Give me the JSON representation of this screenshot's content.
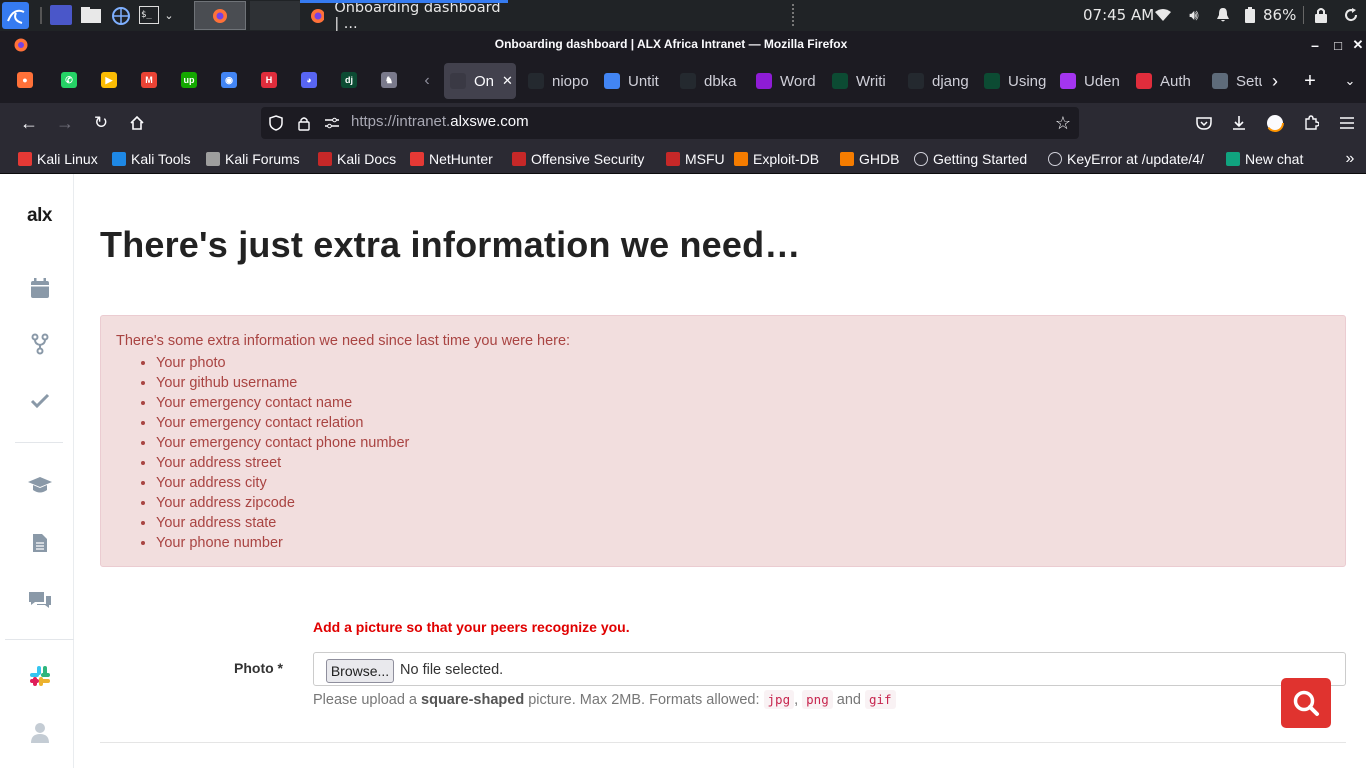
{
  "panel": {
    "active_task": "Onboarding dashboard | ...",
    "time": "07:45 AM",
    "battery": "86%"
  },
  "window": {
    "title": "Onboarding dashboard | ALX Africa Intranet — Mozilla Firefox",
    "minimize": "–",
    "maximize": "□",
    "close": "✕"
  },
  "tabs": {
    "pinned": [
      {
        "name": "firefox",
        "color": "#ff7139",
        "glyph": "●"
      },
      {
        "name": "whatsapp",
        "color": "#25d366",
        "glyph": "✆"
      },
      {
        "name": "play",
        "color": "#fbbc04",
        "glyph": "▶"
      },
      {
        "name": "gmail",
        "color": "#ea4335",
        "glyph": "M"
      },
      {
        "name": "upwork",
        "color": "#14a800",
        "glyph": "up"
      },
      {
        "name": "chrome-like",
        "color": "#4285f4",
        "glyph": "◉"
      },
      {
        "name": "holberton",
        "color": "#e02d3c",
        "glyph": "H"
      },
      {
        "name": "discord",
        "color": "#5865f2",
        "glyph": "◕"
      },
      {
        "name": "django",
        "color": "#0c4b33",
        "glyph": "dj"
      },
      {
        "name": "unicorn",
        "color": "#7a7a8c",
        "glyph": "♞"
      }
    ],
    "open": [
      {
        "label": "On",
        "icon": "alx",
        "color": "#3a3944",
        "active": true
      },
      {
        "label": "niopo",
        "icon": "github",
        "color": "#24292f"
      },
      {
        "label": "Untit",
        "icon": "docs",
        "color": "#4285f4"
      },
      {
        "label": "dbka",
        "icon": "github",
        "color": "#24292f"
      },
      {
        "label": "Word",
        "icon": "u",
        "color": "#8e1cd6"
      },
      {
        "label": "Writi",
        "icon": "dj",
        "color": "#0c4b33"
      },
      {
        "label": "djang",
        "icon": "github",
        "color": "#24292f"
      },
      {
        "label": "Using",
        "icon": "dj",
        "color": "#0c4b33"
      },
      {
        "label": "Uden",
        "icon": "udemy",
        "color": "#a435f0"
      },
      {
        "label": "Auth",
        "icon": "dot",
        "color": "#e02d3c"
      },
      {
        "label": "Setu",
        "icon": "grid",
        "color": "#5e6b7a"
      }
    ]
  },
  "nav": {
    "url_prefix": "https://intranet.",
    "url_domain": "alxswe.com"
  },
  "bookmarks": [
    {
      "label": "Kali Linux",
      "color": "#e53935"
    },
    {
      "label": "Kali Tools",
      "color": "#1e88e5"
    },
    {
      "label": "Kali Forums",
      "color": "#9e9e9e"
    },
    {
      "label": "Kali Docs",
      "color": "#c62828"
    },
    {
      "label": "NetHunter",
      "color": "#e53935"
    },
    {
      "label": "Offensive Security",
      "color": "#c62828"
    },
    {
      "label": "MSFU",
      "color": "#c62828"
    },
    {
      "label": "Exploit-DB",
      "color": "#f57c00"
    },
    {
      "label": "GHDB",
      "color": "#f57c00"
    },
    {
      "label": "Getting Started",
      "color": "#cfcfd8"
    },
    {
      "label": "KeyError at /update/4/",
      "color": "#cfcfd8"
    },
    {
      "label": "New chat",
      "color": "#10a37f"
    }
  ],
  "sidebar": {
    "logo": "alx"
  },
  "page": {
    "heading": "There's just extra information we need…",
    "alert_intro": "There's some extra information we need since last time you were here:",
    "missing": [
      "Your photo",
      "Your github username",
      "Your emergency contact name",
      "Your emergency contact relation",
      "Your emergency contact phone number",
      "Your address street",
      "Your address city",
      "Your address zipcode",
      "Your address state",
      "Your phone number"
    ],
    "photo_prompt": "Add a picture so that your peers recognize you.",
    "photo_label": "Photo *",
    "browse_button": "Browse...",
    "file_status": "No file selected.",
    "help_pre": "Please upload a ",
    "help_bold": "square-shaped",
    "help_mid": " picture. Max 2MB. Formats allowed: ",
    "formats": [
      "jpg",
      "png",
      "gif"
    ],
    "format_sep": ", ",
    "format_and": " and "
  }
}
